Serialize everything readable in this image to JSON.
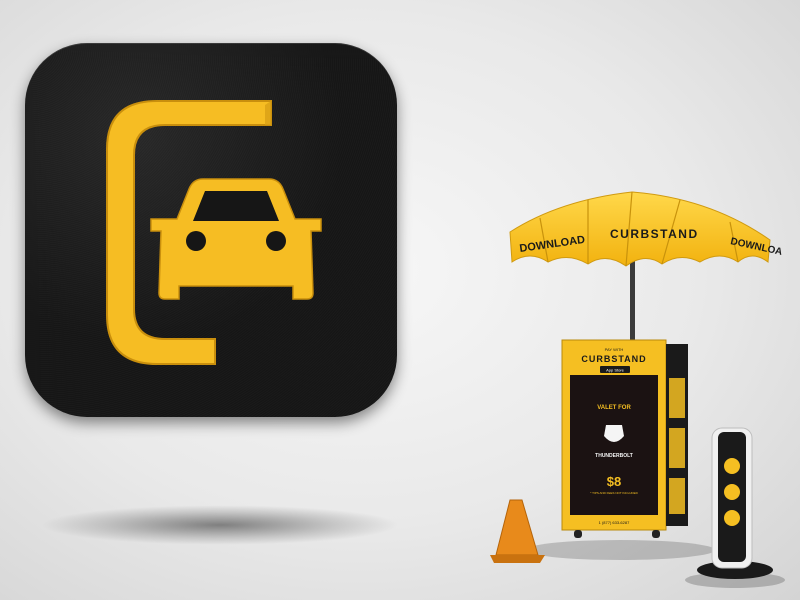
{
  "icon": {
    "name": "curbstand-app-icon",
    "colors": {
      "tile": "#161616",
      "accent": "#f6bd23",
      "accent_dark": "#c98f0d"
    }
  },
  "umbrella": {
    "brand_label": "CURBSTAND",
    "left_label": "DOWNLOAD",
    "right_label": "DOWNLOA"
  },
  "kiosk": {
    "pay_with": "PAY WITH",
    "brand": "CURBSTAND",
    "app_store": "App Store",
    "valet_for": "VALET FOR",
    "partner": "THUNDERBOLT",
    "price": "$8",
    "price_note": "* TIPS AND FEES NOT INCLUDED",
    "phone": "1 (877) 633-6287"
  },
  "colors": {
    "yellow": "#f5bf22",
    "black": "#151515",
    "cone": "#e88a1b"
  }
}
